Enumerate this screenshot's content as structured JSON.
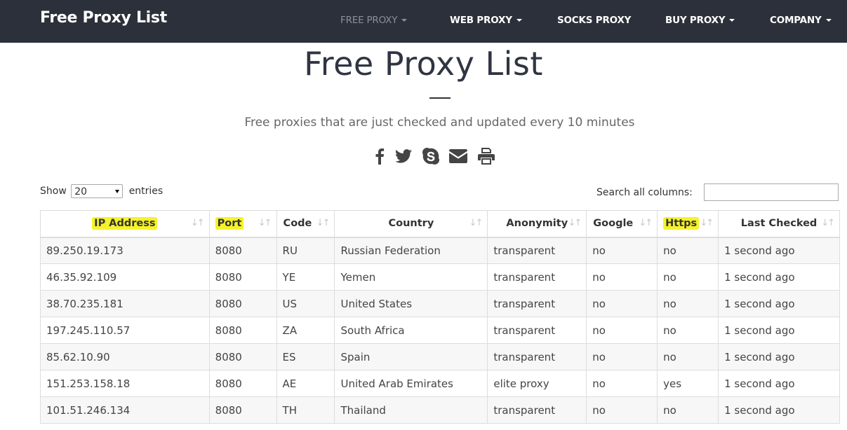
{
  "navbar": {
    "brand": "Free Proxy List",
    "items": [
      {
        "label": "FREE PROXY",
        "active": true
      },
      {
        "label": "WEB PROXY"
      },
      {
        "label": "SOCKS PROXY"
      },
      {
        "label": "BUY PROXY"
      },
      {
        "label": "COMPANY"
      }
    ]
  },
  "hero": {
    "title": "Free Proxy List",
    "subtitle": "Free proxies that are just checked and updated every 10 minutes"
  },
  "share_icons": [
    "facebook-icon",
    "twitter-icon",
    "skype-icon",
    "envelope-icon",
    "print-icon"
  ],
  "controls": {
    "show_label": "Show",
    "entries_value": "20",
    "entries_label": "entries",
    "search_label": "Search all columns:",
    "search_value": ""
  },
  "table": {
    "headers": [
      "IP Address",
      "Port",
      "Code",
      "Country",
      "Anonymity",
      "Google",
      "Https",
      "Last Checked"
    ],
    "rows": [
      [
        "89.250.19.173",
        "8080",
        "RU",
        "Russian Federation",
        "transparent",
        "no",
        "no",
        "1 second ago"
      ],
      [
        "46.35.92.109",
        "8080",
        "YE",
        "Yemen",
        "transparent",
        "no",
        "no",
        "1 second ago"
      ],
      [
        "38.70.235.181",
        "8080",
        "US",
        "United States",
        "transparent",
        "no",
        "no",
        "1 second ago"
      ],
      [
        "197.245.110.57",
        "8080",
        "ZA",
        "South Africa",
        "transparent",
        "no",
        "no",
        "1 second ago"
      ],
      [
        "85.62.10.90",
        "8080",
        "ES",
        "Spain",
        "transparent",
        "no",
        "no",
        "1 second ago"
      ],
      [
        "151.253.158.18",
        "8080",
        "AE",
        "United Arab Emirates",
        "elite proxy",
        "no",
        "yes",
        "1 second ago"
      ],
      [
        "101.51.246.134",
        "8080",
        "TH",
        "Thailand",
        "transparent",
        "no",
        "no",
        "1 second ago"
      ]
    ]
  },
  "colors": {
    "navbar_bg": "#2b303a",
    "highlight": "#f5f22b"
  }
}
